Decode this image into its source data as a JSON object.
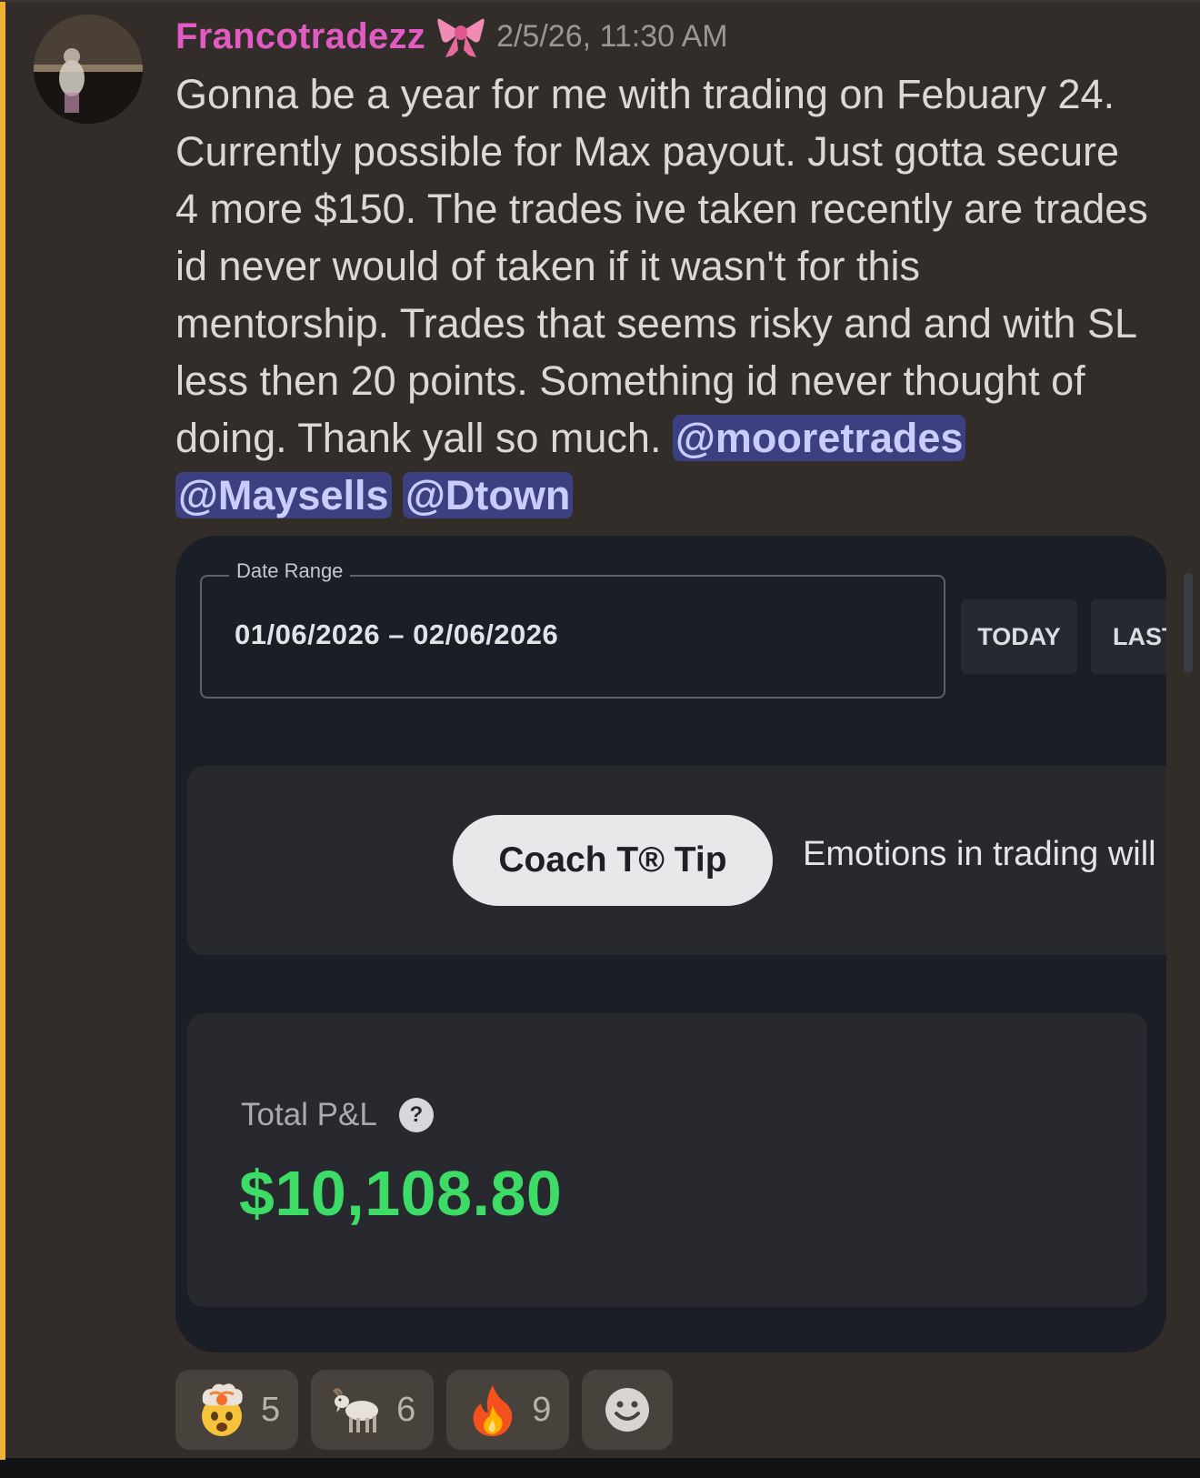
{
  "message": {
    "username": "Francotradezz",
    "timestamp": "2/5/26, 11:30 AM",
    "badge_icon": "ribbon-bow-icon",
    "lines": [
      "Gonna be a year for me with trading on Febuary 24.",
      "Currently possible for Max payout. Just gotta secure",
      "4 more $150. The trades ive taken recently are trades",
      "id never would of taken if it wasn't for this",
      "mentorship. Trades that seems risky and  and with SL",
      "less then 20 points. Something id never thought of",
      "doing. Thank yall so much. "
    ],
    "mentions": [
      "@mooretrades",
      "@Maysells",
      "@Dtown"
    ],
    "colors": {
      "username": "#e25bc3",
      "accent_bar": "#f0b232",
      "mention_bg": "#3c3f80",
      "mention_text": "#c9cdfb"
    }
  },
  "attachment": {
    "date_range_label": "Date Range",
    "date_range_value": "01/06/2026 – 02/06/2026",
    "today_button": "TODAY",
    "last_button": "LAST",
    "tip_label": "Coach T® Tip",
    "tip_text": "Emotions in trading will",
    "pnl_label": "Total P&L",
    "pnl_help": "?",
    "pnl_value": "$10,108.80",
    "pnl_color": "#3ddc67"
  },
  "reactions": [
    {
      "emoji": "exploding-head-icon",
      "count": "5"
    },
    {
      "emoji": "goat-icon",
      "count": "6"
    },
    {
      "emoji": "fire-icon",
      "count": "9"
    },
    {
      "emoji": "add-reaction-smiley-icon",
      "count": ""
    }
  ]
}
